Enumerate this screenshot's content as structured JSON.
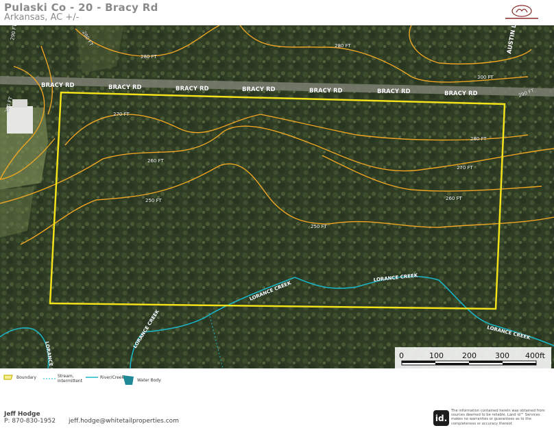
{
  "header": {
    "title": "Pulaski Co - 20 - Bracy Rd",
    "subtitle": "Arkansas,  AC +/-"
  },
  "map": {
    "road_labels": [
      "BRACY RD",
      "BRACY RD",
      "BRACY RD",
      "BRACY RD",
      "BRACY RD",
      "BRACY RD",
      "BRACY RD",
      "AUSTIN L"
    ],
    "contour_labels": [
      "290 FT",
      "280 FT",
      "280 FT",
      "290 FT",
      "280 FT",
      "270 FT",
      "260 FT",
      "250 FT",
      "300 FT",
      "270 FT",
      "250 FT",
      "260 FT",
      "280 FT",
      "290 FT"
    ],
    "creek_labels": [
      "LORANCE CREEK",
      "LORANCE CREEK",
      "LORANCE CREEK",
      "LORANCE CREEK",
      "LORANCE CREEK"
    ],
    "scale": {
      "ticks": [
        "0",
        "100",
        "200",
        "300",
        "400ft"
      ]
    },
    "colors": {
      "boundary": "#f2e21b",
      "contour": "#f0a623",
      "creek": "#1ab5c7",
      "forest": "#2f3d24"
    }
  },
  "legend": {
    "boundary": "Boundary",
    "stream": "Stream, Intermittent",
    "river": "River/Creek",
    "water": "Water Body"
  },
  "footer": {
    "agent_name": "Jeff Hodge",
    "agent_phone": "P: 870-830-1952",
    "agent_email": "jeff.hodge@whitetailproperties.com",
    "disclaimer": "The information contained herein was obtained from sources deemed to be reliable. Land id™ Services makes no warranties or guarantees as to the completeness or accuracy thereof.",
    "badge": "id."
  }
}
